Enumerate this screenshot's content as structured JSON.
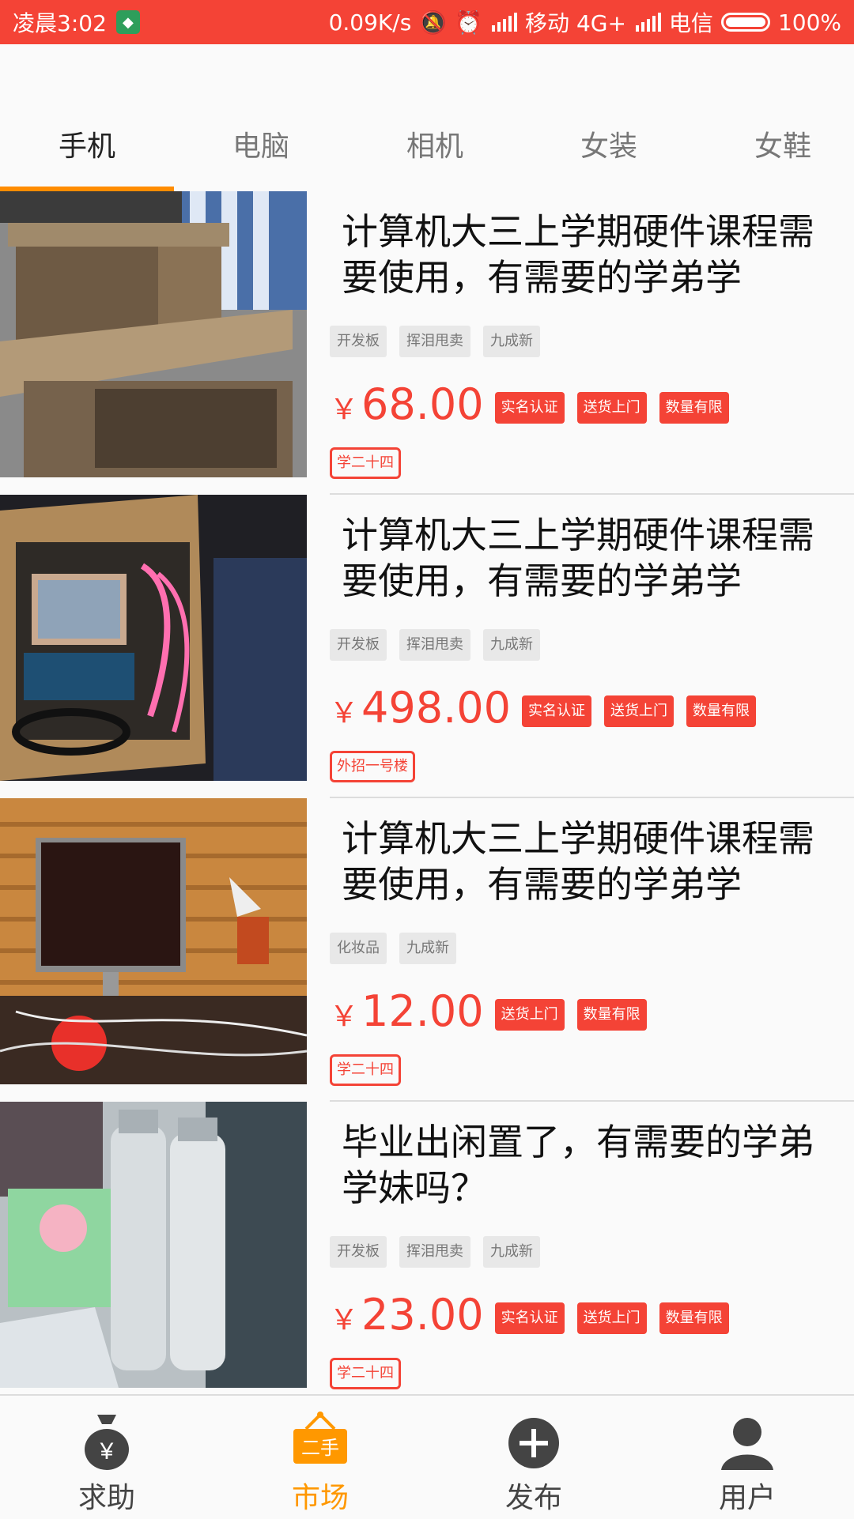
{
  "status": {
    "time": "凌晨3:02",
    "speed": "0.09K/s",
    "carrier1": "移动 4G+",
    "carrier2": "电信",
    "battery": "100%"
  },
  "tabs": [
    {
      "label": "手机",
      "active": true
    },
    {
      "label": "电脑",
      "active": false
    },
    {
      "label": "相机",
      "active": false
    },
    {
      "label": "女装",
      "active": false
    },
    {
      "label": "女鞋",
      "active": false
    }
  ],
  "items": [
    {
      "title": "计算机大三上学期硬件课程需要使用，有需要的学弟学",
      "tags": [
        "开发板",
        "挥泪甩卖",
        "九成新"
      ],
      "currency": "￥",
      "price": "68.00",
      "badges": [
        "实名认证",
        "送货上门",
        "数量有限"
      ],
      "location": "学二十四"
    },
    {
      "title": "计算机大三上学期硬件课程需要使用，有需要的学弟学",
      "tags": [
        "开发板",
        "挥泪甩卖",
        "九成新"
      ],
      "currency": "￥",
      "price": "498.00",
      "badges": [
        "实名认证",
        "送货上门",
        "数量有限"
      ],
      "location": "外招一号楼"
    },
    {
      "title": "计算机大三上学期硬件课程需要使用，有需要的学弟学",
      "tags": [
        "化妆品",
        "九成新"
      ],
      "currency": "￥",
      "price": "12.00",
      "badges": [
        "送货上门",
        "数量有限"
      ],
      "location": "学二十四"
    },
    {
      "title": "毕业出闲置了，有需要的学弟学妹吗？",
      "tags": [
        "开发板",
        "挥泪甩卖",
        "九成新"
      ],
      "currency": "￥",
      "price": "23.00",
      "badges": [
        "实名认证",
        "送货上门",
        "数量有限"
      ],
      "location": "学二十四"
    }
  ],
  "bottom_nav": [
    {
      "label": "求助",
      "icon": "money-bag-icon",
      "active": false
    },
    {
      "label": "市场",
      "icon": "secondhand-sign-icon",
      "icon_text": "二手",
      "active": true
    },
    {
      "label": "发布",
      "icon": "plus-circle-icon",
      "active": false
    },
    {
      "label": "用户",
      "icon": "user-icon",
      "active": false
    }
  ],
  "colors": {
    "accent": "#f44336",
    "orange": "#ff9800"
  }
}
